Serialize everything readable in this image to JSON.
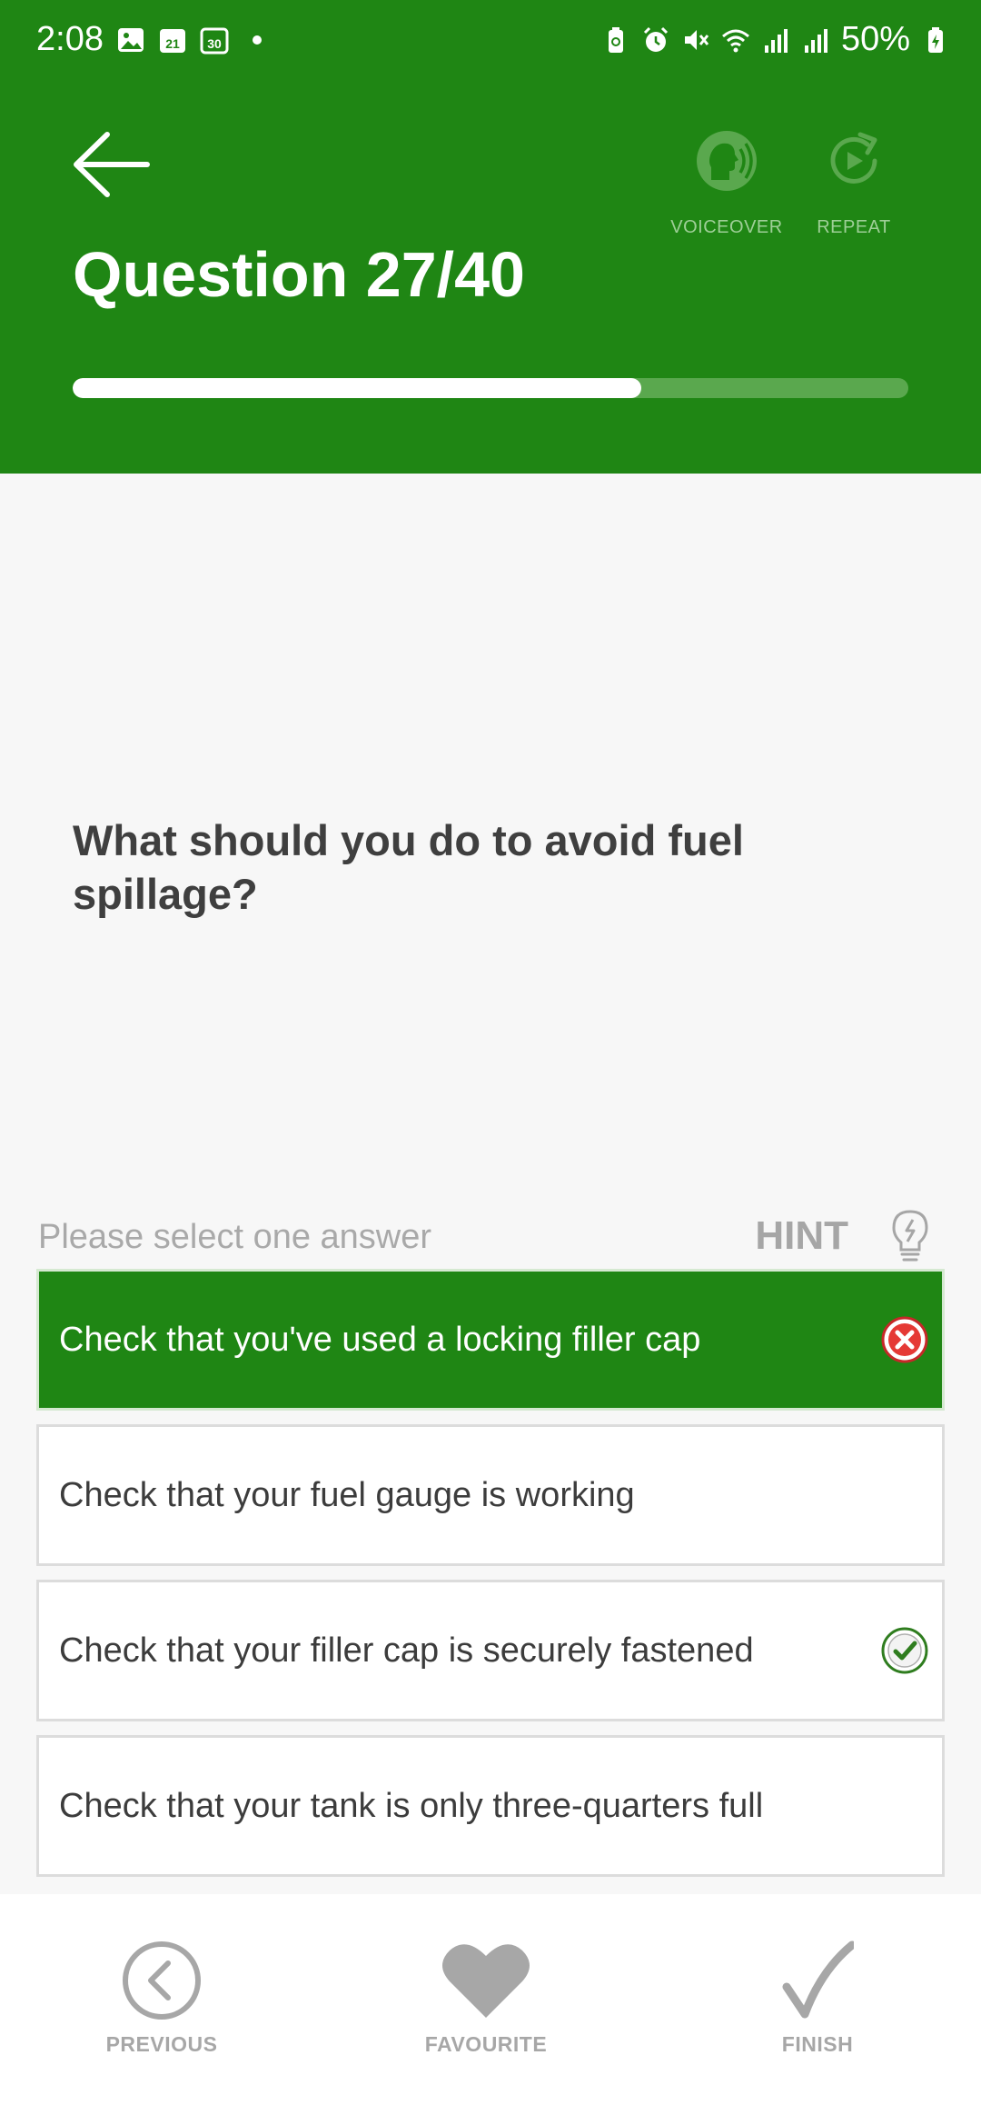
{
  "status_bar": {
    "time": "2:08",
    "left_icons": [
      "gallery-icon",
      "calendar-21-icon",
      "calendar-30-icon",
      "notification-dot-icon"
    ],
    "right_icons": [
      "battery-saver-icon",
      "alarm-icon",
      "mute-icon",
      "wifi-icon",
      "signal-icon",
      "signal-icon"
    ],
    "battery": "50%"
  },
  "header": {
    "background": "#1f8614",
    "title": "Question 27/40",
    "voiceover_label": "VOICEOVER",
    "repeat_label": "REPEAT",
    "progress_fraction": 0.68
  },
  "question": {
    "text": "What should you do to avoid fuel spillage?"
  },
  "answers_section": {
    "instruction": "Please select one answer",
    "hint_label": "HINT",
    "answers": [
      {
        "text": "Check that you've used a locking filler cap",
        "selected": true,
        "mark": "wrong-icon"
      },
      {
        "text": "Check that your fuel gauge is working",
        "selected": false,
        "mark": ""
      },
      {
        "text": "Check that your filler cap is securely fastened",
        "selected": false,
        "mark": "correct-icon"
      },
      {
        "text": "Check that your tank is only three-quarters full",
        "selected": false,
        "mark": ""
      }
    ]
  },
  "bottom_nav": {
    "previous_label": "PREVIOUS",
    "favourite_label": "FAVOURITE",
    "finish_label": "FINISH"
  }
}
